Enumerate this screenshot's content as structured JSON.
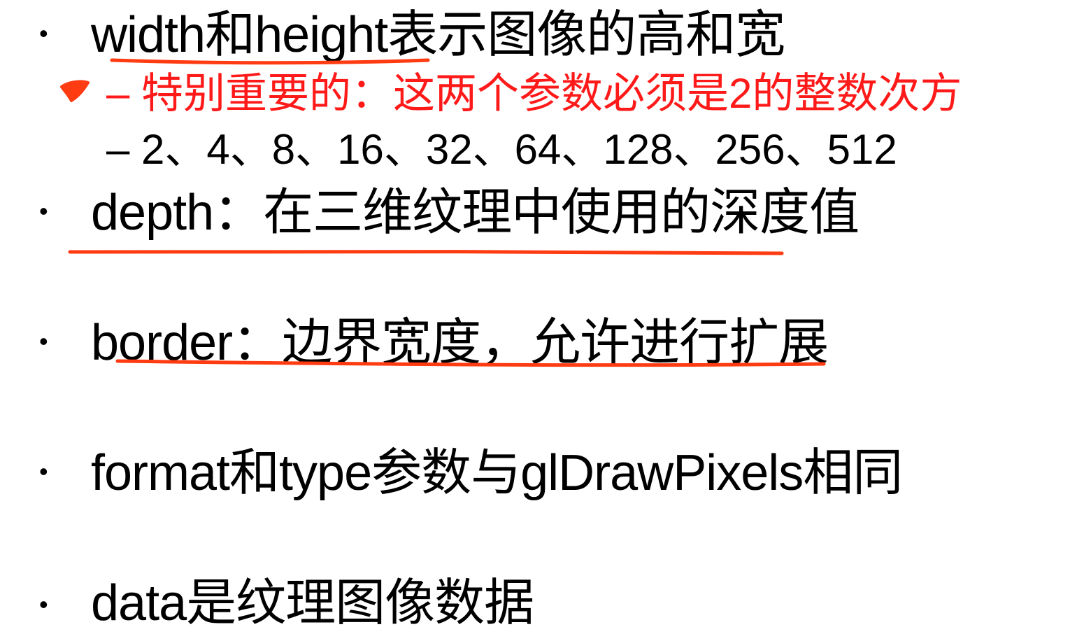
{
  "slide": {
    "items": [
      {
        "bullet": "•",
        "text": "width和height表示图像的高和宽"
      },
      {
        "dash": "–",
        "text": "特别重要的：这两个参数必须是2的整数次方"
      },
      {
        "dash": "–",
        "text": "2、4、8、16、32、64、128、256、512"
      },
      {
        "bullet": "•",
        "text": "depth：在三维纹理中使用的深度值"
      },
      {
        "bullet": "•",
        "text": "border：边界宽度，允许进行扩展"
      },
      {
        "bullet": "•",
        "text": "format和type参数与glDrawPixels相同"
      },
      {
        "bullet": "•",
        "text": "data是纹理图像数据"
      }
    ]
  },
  "annotations": {
    "ink_color": "#ff3b12",
    "marks": [
      "underline",
      "check-mark",
      "underline",
      "underline"
    ]
  },
  "colors": {
    "text": "#000000",
    "emphasis": "#ff1a1a"
  }
}
